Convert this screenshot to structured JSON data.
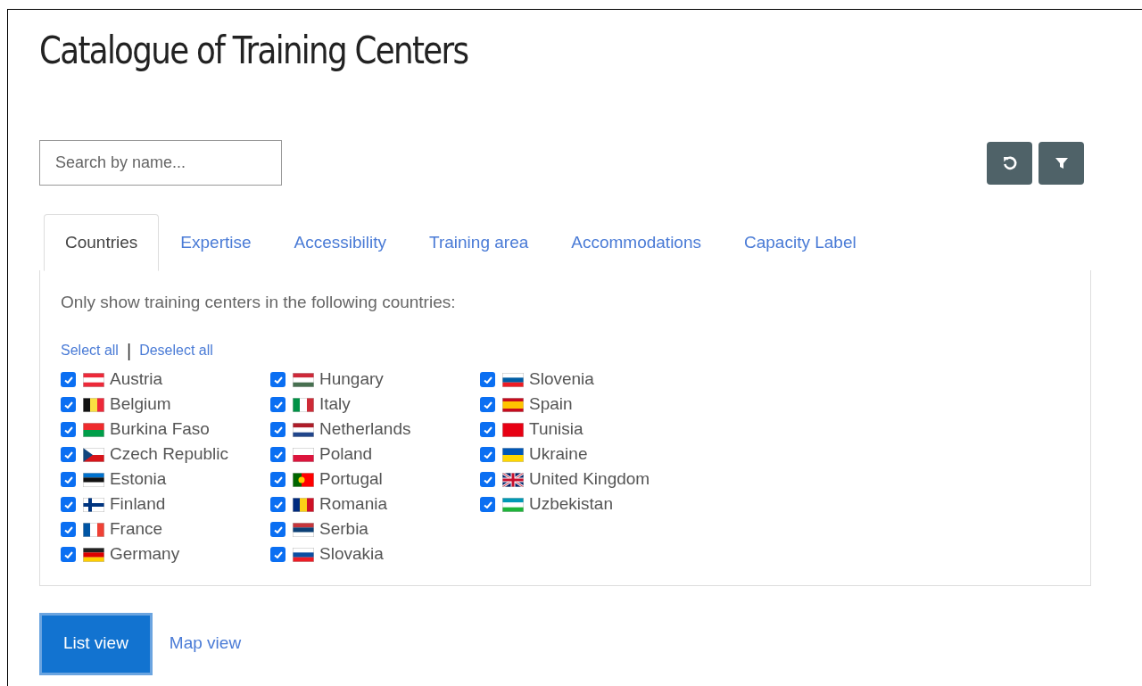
{
  "title": "Catalogue of Training Centers",
  "search": {
    "placeholder": "Search by name..."
  },
  "tabs": [
    {
      "label": "Countries",
      "selected": true
    },
    {
      "label": "Expertise",
      "selected": false
    },
    {
      "label": "Accessibility",
      "selected": false
    },
    {
      "label": "Training area",
      "selected": false
    },
    {
      "label": "Accommodations",
      "selected": false
    },
    {
      "label": "Capacity Label",
      "selected": false
    }
  ],
  "panel": {
    "intro": "Only show training centers in the following countries:",
    "select_all": "Select all",
    "separator": "|",
    "deselect_all": "Deselect all"
  },
  "countries": [
    {
      "name": "Austria",
      "checked": true
    },
    {
      "name": "Belgium",
      "checked": true
    },
    {
      "name": "Burkina Faso",
      "checked": true
    },
    {
      "name": "Czech Republic",
      "checked": true
    },
    {
      "name": "Estonia",
      "checked": true
    },
    {
      "name": "Finland",
      "checked": true
    },
    {
      "name": "France",
      "checked": true
    },
    {
      "name": "Germany",
      "checked": true
    },
    {
      "name": "Hungary",
      "checked": true
    },
    {
      "name": "Italy",
      "checked": true
    },
    {
      "name": "Netherlands",
      "checked": true
    },
    {
      "name": "Poland",
      "checked": true
    },
    {
      "name": "Portugal",
      "checked": true
    },
    {
      "name": "Romania",
      "checked": true
    },
    {
      "name": "Serbia",
      "checked": true
    },
    {
      "name": "Slovakia",
      "checked": true
    },
    {
      "name": "Slovenia",
      "checked": true
    },
    {
      "name": "Spain",
      "checked": true
    },
    {
      "name": "Tunisia",
      "checked": true
    },
    {
      "name": "Ukraine",
      "checked": true
    },
    {
      "name": "United Kingdom",
      "checked": true
    },
    {
      "name": "Uzbekistan",
      "checked": true
    }
  ],
  "views": [
    {
      "label": "List view",
      "selected": true
    },
    {
      "label": "Map view",
      "selected": false
    }
  ]
}
